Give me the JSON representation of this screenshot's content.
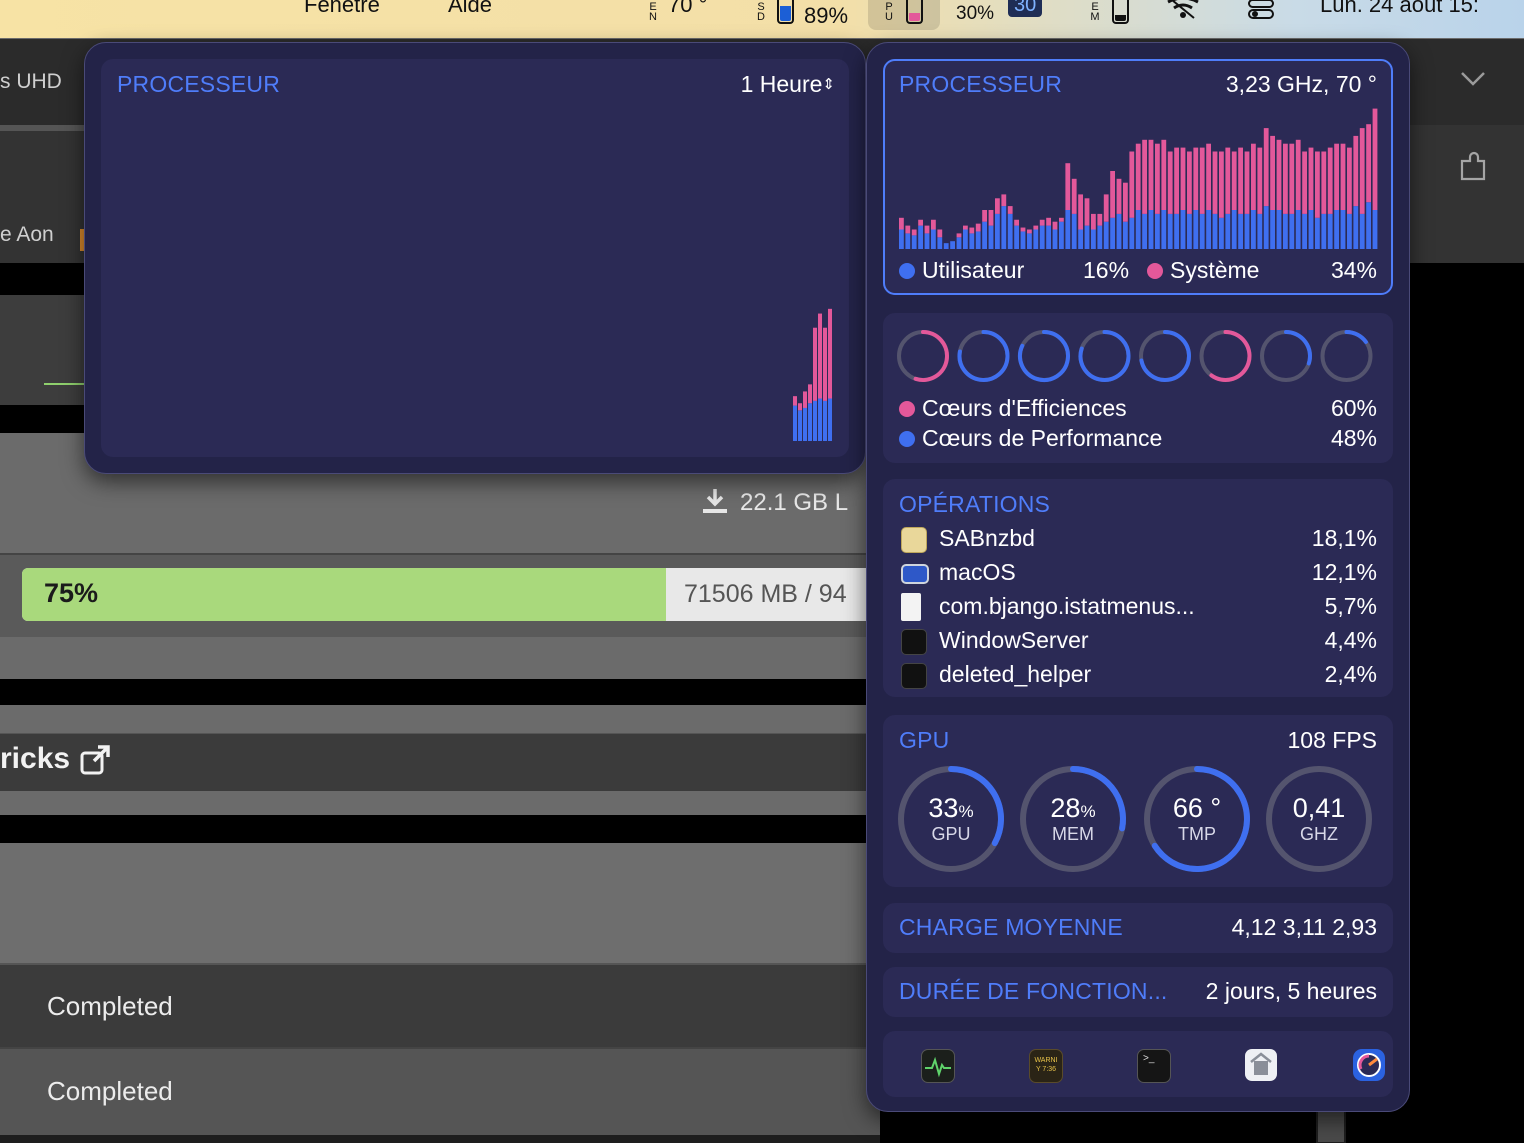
{
  "menubar": {
    "items": [
      "Fenêtre",
      "Aide"
    ],
    "temp_label": "70 °",
    "ssd_percent": "89%",
    "cpu_percent": "30%",
    "badge": "30",
    "clock": "Lun. 24 août 15:"
  },
  "background": {
    "tab_fragment": "s UHD",
    "aon_fragment": "e Aon",
    "download_size": "22.1 GB L",
    "progress_percent": "75%",
    "progress_fraction": 0.75,
    "progress_detail": "71506 MB / 94",
    "tricks_heading": "ricks",
    "status_rows": [
      "Completed",
      "Completed"
    ],
    "accent_green": "#a9d97c"
  },
  "history_panel": {
    "title": "PROCESSEUR",
    "range": "1 Heure",
    "bars": [
      {
        "user": 30,
        "system": 8
      },
      {
        "user": 26,
        "system": 6
      },
      {
        "user": 28,
        "system": 14
      },
      {
        "user": 32,
        "system": 16
      },
      {
        "user": 34,
        "system": 62
      },
      {
        "user": 36,
        "system": 72
      },
      {
        "user": 34,
        "system": 62
      },
      {
        "user": 36,
        "system": 76
      }
    ]
  },
  "cpu": {
    "title": "PROCESSEUR",
    "freq_temp": "3,23 GHz, 70 °",
    "user_label": "Utilisateur",
    "user_value": "16%",
    "system_label": "Système",
    "system_value": "34%",
    "user_color": "#3f6ff0",
    "system_color": "#e3589a",
    "history": [
      [
        10,
        6
      ],
      [
        8,
        4
      ],
      [
        7,
        3
      ],
      [
        12,
        3
      ],
      [
        8,
        4
      ],
      [
        10,
        5
      ],
      [
        6,
        4
      ],
      [
        3,
        0
      ],
      [
        4,
        0
      ],
      [
        6,
        2
      ],
      [
        10,
        2
      ],
      [
        8,
        3
      ],
      [
        9,
        4
      ],
      [
        14,
        6
      ],
      [
        12,
        8
      ],
      [
        18,
        8
      ],
      [
        22,
        6
      ],
      [
        18,
        4
      ],
      [
        12,
        3
      ],
      [
        9,
        2
      ],
      [
        8,
        2
      ],
      [
        10,
        2
      ],
      [
        12,
        3
      ],
      [
        12,
        4
      ],
      [
        10,
        4
      ],
      [
        14,
        2
      ],
      [
        20,
        24
      ],
      [
        18,
        18
      ],
      [
        10,
        18
      ],
      [
        12,
        14
      ],
      [
        10,
        8
      ],
      [
        12,
        6
      ],
      [
        14,
        14
      ],
      [
        16,
        24
      ],
      [
        18,
        18
      ],
      [
        14,
        20
      ],
      [
        16,
        34
      ],
      [
        20,
        34
      ],
      [
        18,
        38
      ],
      [
        20,
        36
      ],
      [
        18,
        36
      ],
      [
        20,
        36
      ],
      [
        18,
        32
      ],
      [
        18,
        34
      ],
      [
        20,
        32
      ],
      [
        18,
        32
      ],
      [
        20,
        32
      ],
      [
        18,
        34
      ],
      [
        20,
        34
      ],
      [
        18,
        32
      ],
      [
        16,
        34
      ],
      [
        18,
        34
      ],
      [
        20,
        30
      ],
      [
        18,
        34
      ],
      [
        18,
        32
      ],
      [
        20,
        34
      ],
      [
        18,
        34
      ],
      [
        22,
        40
      ],
      [
        20,
        38
      ],
      [
        20,
        36
      ],
      [
        18,
        36
      ],
      [
        18,
        36
      ],
      [
        20,
        36
      ],
      [
        18,
        32
      ],
      [
        20,
        32
      ],
      [
        16,
        34
      ],
      [
        18,
        32
      ],
      [
        18,
        34
      ],
      [
        20,
        34
      ],
      [
        20,
        34
      ],
      [
        18,
        34
      ],
      [
        22,
        36
      ],
      [
        18,
        44
      ],
      [
        24,
        40
      ],
      [
        20,
        52
      ]
    ]
  },
  "cores": {
    "efficiency_label": "Cœurs d'Efficiences",
    "efficiency_value": "60%",
    "performance_label": "Cœurs de Performance",
    "performance_value": "48%",
    "rings": [
      {
        "color": "#e3589a",
        "fraction": 0.55
      },
      {
        "color": "#3f6ff0",
        "fraction": 0.78
      },
      {
        "color": "#3f6ff0",
        "fraction": 0.82
      },
      {
        "color": "#3f6ff0",
        "fraction": 0.8
      },
      {
        "color": "#3f6ff0",
        "fraction": 0.72
      },
      {
        "color": "#e3589a",
        "fraction": 0.6
      },
      {
        "color": "#3f6ff0",
        "fraction": 0.3
      },
      {
        "color": "#3f6ff0",
        "fraction": 0.15
      }
    ]
  },
  "operations": {
    "title": "OPÉRATIONS",
    "processes": [
      {
        "name": "SABnzbd",
        "value": "18,1%",
        "icon": "sabnzbd-icon"
      },
      {
        "name": "macOS",
        "value": "12,1%",
        "icon": "macos-icon"
      },
      {
        "name": "com.bjango.istatmenus...",
        "value": "5,7%",
        "icon": "document-icon"
      },
      {
        "name": "WindowServer",
        "value": "4,4%",
        "icon": "exec-icon"
      },
      {
        "name": "deleted_helper",
        "value": "2,4%",
        "icon": "exec-icon"
      }
    ]
  },
  "gpu": {
    "title": "GPU",
    "fps": "108 FPS",
    "gauges": [
      {
        "value": "33",
        "unit": "%",
        "label": "GPU",
        "fraction": 0.33
      },
      {
        "value": "28",
        "unit": "%",
        "label": "MEM",
        "fraction": 0.28
      },
      {
        "value": "66 °",
        "unit": "",
        "label": "TMP",
        "fraction": 0.66
      },
      {
        "value": "0,41",
        "unit": "",
        "label": "GHZ",
        "fraction": 0.0
      }
    ]
  },
  "load": {
    "title": "CHARGE MOYENNE",
    "values": "4,12 3,11 2,93"
  },
  "uptime": {
    "title": "DURÉE DE FONCTION...",
    "value": "2 jours, 5 heures"
  },
  "dock": {
    "icons": [
      "activity-monitor-icon",
      "console-icon",
      "terminal-icon",
      "system-info-icon",
      "istat-menus-icon"
    ],
    "console_text_1": "WARNI",
    "console_text_2": "Y 7:36"
  }
}
